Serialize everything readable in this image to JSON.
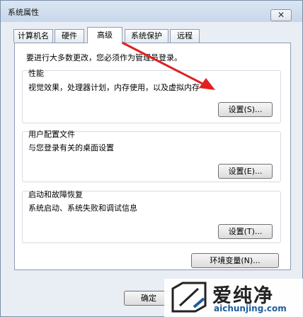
{
  "window": {
    "title": "系统属性",
    "close_symbol": "✕"
  },
  "tabs": [
    {
      "label": "计算机名"
    },
    {
      "label": "硬件"
    },
    {
      "label": "高级"
    },
    {
      "label": "系统保护"
    },
    {
      "label": "远程"
    }
  ],
  "notice": "要进行大多数更改，您必须作为管理员登录。",
  "groups": {
    "performance": {
      "title": "性能",
      "desc": "视觉效果，处理器计划，内存使用，以及虚拟内存",
      "button": "设置(S)..."
    },
    "profile": {
      "title": "用户配置文件",
      "desc": "与您登录有关的桌面设置",
      "button": "设置(E)..."
    },
    "startup": {
      "title": "启动和故障恢复",
      "desc": "系统启动、系统失败和调试信息",
      "button": "设置(T)..."
    }
  },
  "env_button": "环境变量(N)...",
  "ok_button": "确定",
  "watermark": {
    "text": "爱纯净",
    "url": "aichunjing.com"
  },
  "colors": {
    "arrow": "#e02020",
    "accent": "#1f5d9c"
  }
}
